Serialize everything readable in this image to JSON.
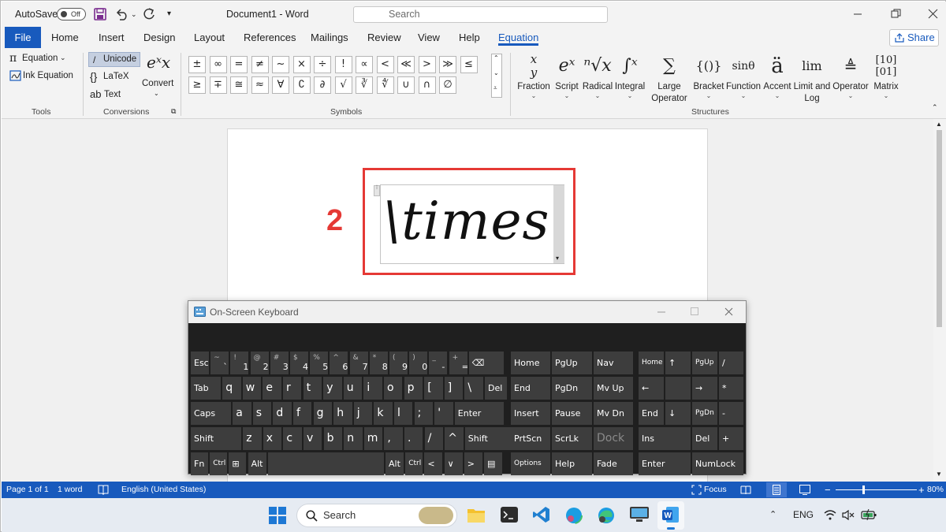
{
  "titlebar": {
    "autosave_label": "AutoSave",
    "autosave_state": "Off",
    "document_title": "Document1  -  Word",
    "search_placeholder": "Search"
  },
  "menubar": {
    "tabs": [
      "File",
      "Home",
      "Insert",
      "Design",
      "Layout",
      "References",
      "Mailings",
      "Review",
      "View",
      "Help",
      "Equation"
    ],
    "active_tab": "Equation",
    "share_label": "Share"
  },
  "ribbon": {
    "tools": {
      "equation_label": "Equation",
      "ink_equation_label": "Ink Equation",
      "group_label": "Tools"
    },
    "conversions": {
      "unicode_label": "Unicode",
      "latex_label": "LaTeX",
      "text_label": "Text",
      "convert_label": "Convert",
      "group_label": "Conversions"
    },
    "symbols": {
      "row1": [
        "±",
        "∞",
        "=",
        "≠",
        "~",
        "×",
        "÷",
        "!",
        "∝",
        "<",
        "≪",
        ">",
        "≫",
        "≤"
      ],
      "row2": [
        "≥",
        "∓",
        "≅",
        "≈",
        "∀",
        "∁",
        "∂",
        "√",
        "∛",
        "∜",
        "∪",
        "∩",
        "∅"
      ],
      "group_label": "Symbols"
    },
    "structures": {
      "items": [
        "Fraction",
        "Script",
        "Radical",
        "Integral",
        "Large Operator",
        "Bracket",
        "Function",
        "Accent",
        "Limit and Log",
        "Operator",
        "Matrix"
      ],
      "group_label": "Structures"
    }
  },
  "document": {
    "step_number": "2",
    "equation_text": "\\times"
  },
  "osk": {
    "title": "On-Screen Keyboard",
    "row1": [
      {
        "main": "Esc"
      },
      {
        "main": "`",
        "shift": "~"
      },
      {
        "main": "1",
        "shift": "!"
      },
      {
        "main": "2",
        "shift": "@"
      },
      {
        "main": "3",
        "shift": "#"
      },
      {
        "main": "4",
        "shift": "$"
      },
      {
        "main": "5",
        "shift": "%"
      },
      {
        "main": "6",
        "shift": "^"
      },
      {
        "main": "7",
        "shift": "&"
      },
      {
        "main": "8",
        "shift": "*"
      },
      {
        "main": "9",
        "shift": "("
      },
      {
        "main": "0",
        "shift": ")"
      },
      {
        "main": "-",
        "shift": "_"
      },
      {
        "main": "=",
        "shift": "+"
      },
      {
        "main": "⌫"
      }
    ],
    "row2": [
      "Tab",
      "q",
      "w",
      "e",
      "r",
      "t",
      "y",
      "u",
      "i",
      "o",
      "p",
      "[",
      "]",
      "\\",
      "Del"
    ],
    "row3": [
      "Caps",
      "a",
      "s",
      "d",
      "f",
      "g",
      "h",
      "j",
      "k",
      "l",
      ";",
      "'",
      "Enter"
    ],
    "row4": [
      "Shift",
      "z",
      "x",
      "c",
      "v",
      "b",
      "n",
      "m",
      ",",
      ".",
      "/",
      "^",
      "Shift"
    ],
    "row5": [
      "Fn",
      "Ctrl",
      "⊞",
      "Alt",
      "",
      "Alt",
      "Ctrl",
      "<",
      "∨",
      ">",
      "▤"
    ],
    "nav": [
      [
        "Home",
        "PgUp",
        "Nav"
      ],
      [
        "End",
        "PgDn",
        "Mv Up"
      ],
      [
        "Insert",
        "Pause",
        "Mv Dn"
      ],
      [
        "PrtScn",
        "ScrLk",
        "Dock"
      ],
      [
        "Options",
        "Help",
        "Fade"
      ]
    ],
    "numpad": [
      [
        "Home",
        "↑",
        "PgUp",
        "/"
      ],
      [
        "←",
        "",
        "→",
        "*"
      ],
      [
        "End",
        "↓",
        "PgDn",
        "-"
      ],
      [
        "Ins",
        "",
        "Del",
        "+"
      ],
      [
        "Enter",
        "",
        "NumLock",
        ""
      ]
    ]
  },
  "statusbar": {
    "page": "Page 1 of 1",
    "words": "1 word",
    "language": "English (United States)",
    "focus": "Focus",
    "zoom": "80%"
  },
  "taskbar": {
    "search_label": "Search",
    "language": "ENG"
  }
}
